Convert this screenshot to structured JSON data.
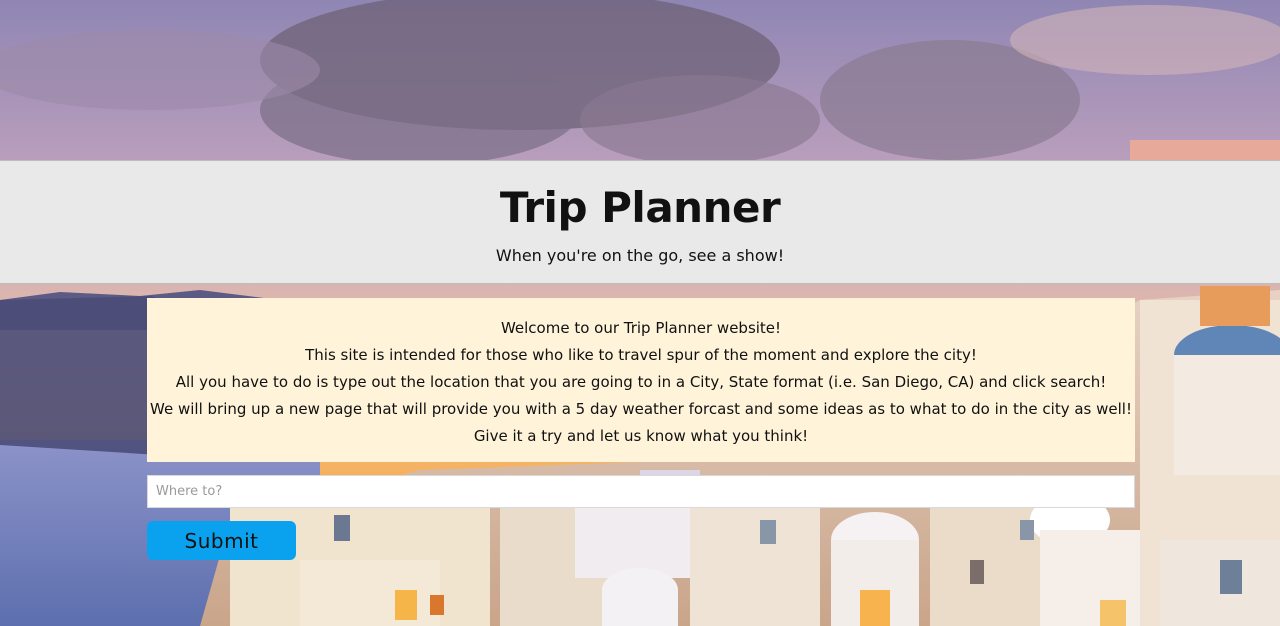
{
  "header": {
    "title": "Trip Planner",
    "subtitle": "When you're on the go, see a show!"
  },
  "intro": {
    "lines": [
      "Welcome to our Trip Planner website!",
      "This site is intended for those who like to travel spur of the moment and explore the city!",
      "All you have to do is type out the location that you are going to in a City, State format (i.e. San Diego, CA) and click search!",
      "We will bring up a new page that will provide you with a 5 day weather forcast and some ideas as to what to do in the city as well! Give it a try and let us know what you think!"
    ]
  },
  "search": {
    "value": "",
    "placeholder": "Where to?"
  },
  "submit": {
    "label": "Submit"
  },
  "colors": {
    "header_bg": "#e9e9e9",
    "intro_bg": "#fff3da",
    "button_bg": "#0aa2ee"
  },
  "background": {
    "scene": "sunset-over-whitewashed-village-and-sea"
  }
}
